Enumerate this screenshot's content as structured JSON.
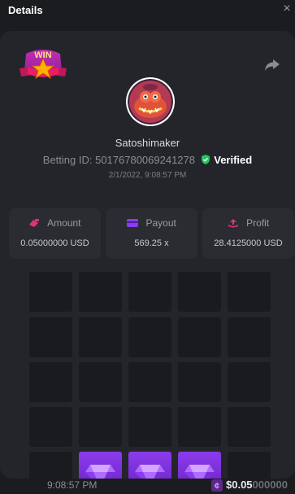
{
  "header": {
    "title": "Details",
    "close_label": "×"
  },
  "win_badge": {
    "text": "WIN"
  },
  "profile": {
    "username": "Satoshimaker",
    "betting_id_text": "Betting ID: 50176780069241278",
    "verified_label": "Verified",
    "datetime": "2/1/2022, 9:08:57 PM"
  },
  "stats": [
    {
      "label": "Amount",
      "value": "0.05000000 USD",
      "icon": "amount-icon",
      "color": "#e0337a"
    },
    {
      "label": "Payout",
      "value": "569.25 x",
      "icon": "payout-icon",
      "color": "#8a3cf0"
    },
    {
      "label": "Profit",
      "value": "28.4125000 USD",
      "icon": "profit-icon",
      "color": "#e0337a"
    }
  ],
  "grid": {
    "rows": [
      [
        "empty",
        "empty",
        "empty",
        "empty",
        "empty"
      ],
      [
        "empty",
        "empty",
        "empty",
        "empty",
        "empty"
      ],
      [
        "empty",
        "empty",
        "empty",
        "empty",
        "empty"
      ],
      [
        "empty",
        "empty",
        "empty",
        "empty",
        "empty"
      ],
      [
        "empty",
        "gem",
        "gem",
        "gem",
        "empty"
      ]
    ]
  },
  "footer": {
    "time": "9:08:57 PM",
    "amount_bright": "$0.05",
    "amount_faint": "000000"
  },
  "colors": {
    "background": "#1b1c1f",
    "panel": "#24252a",
    "card": "#2b2c32",
    "tile": "#1a1b1e",
    "gem": "#7a2fd6",
    "verified": "#22c55e"
  }
}
